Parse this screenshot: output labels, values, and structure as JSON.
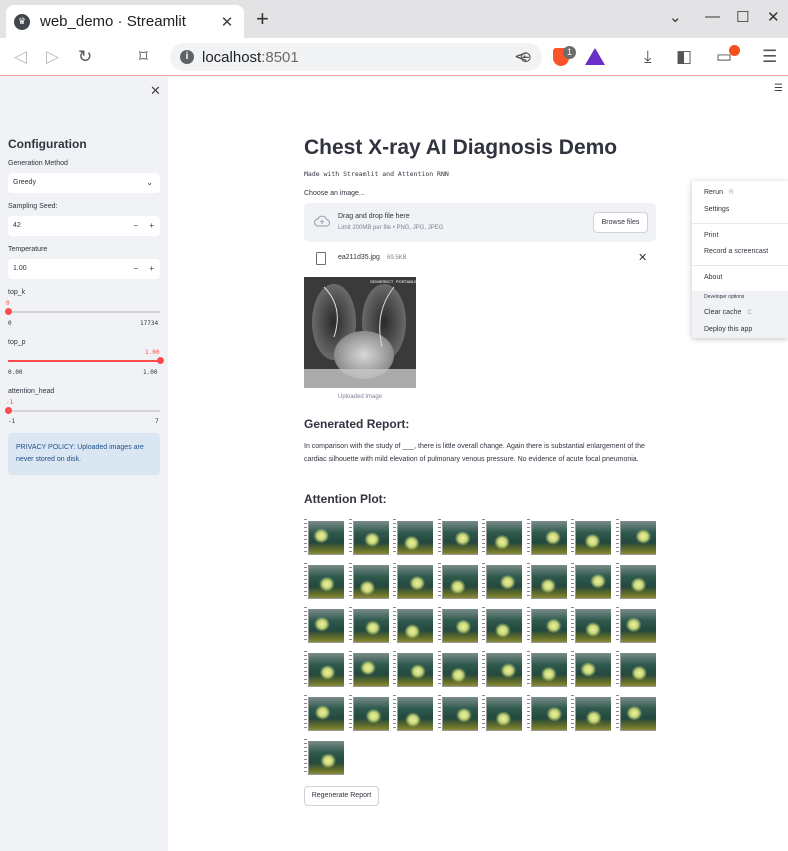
{
  "browser": {
    "tab_title": "web_demo · Streamlit",
    "url_host": "localhost",
    "url_port": ":8501",
    "brave_badge": "1"
  },
  "sidebar": {
    "title": "Configuration",
    "generation_method": {
      "label": "Generation Method",
      "value": "Greedy"
    },
    "sampling_seed": {
      "label": "Sampling Seed:",
      "value": "42"
    },
    "temperature": {
      "label": "Temperature",
      "value": "1.00"
    },
    "top_k": {
      "label": "top_k",
      "value": "0",
      "min": "0",
      "max": "17734",
      "fraction": 0.0
    },
    "top_p": {
      "label": "top_p",
      "value": "1.00",
      "min": "0.00",
      "max": "1.00",
      "fraction": 1.0
    },
    "attention_head": {
      "label": "attention_head",
      "value": "-1",
      "min": "-1",
      "max": "7",
      "fraction": 0.0
    },
    "privacy": "PRIVACY POLICY: Uploaded images are never stored on disk."
  },
  "main": {
    "title": "Chest X-ray AI Diagnosis Demo",
    "subtitle": "Made with Streamlit and Attention RNN",
    "uploader": {
      "label": "Choose an image...",
      "drop_title": "Drag and drop file here",
      "drop_sub": "Limit 200MB per file • PNG, JPG, JPEG",
      "browse": "Browse files"
    },
    "file": {
      "name": "ea211d35.jpg",
      "size": "69.5KB"
    },
    "image_caption": "Uploaded Image",
    "report_heading": "Generated Report:",
    "report_text": "In comparison with the study of ___, there is little overall change. Again there is substantial enlargement of the cardiac silhouette with mild elevation of pulmonary venous pressure. No evidence of acute focal pneumonia.",
    "attention_heading": "Attention Plot:",
    "attention_tiles": 41,
    "regenerate": "Regenerate Report"
  },
  "menu": {
    "rerun": "Rerun",
    "rerun_key": "R",
    "settings": "Settings",
    "print": "Print",
    "record": "Record a screencast",
    "about": "About",
    "dev_label": "Developer options",
    "clear_cache": "Clear cache",
    "clear_key": "C",
    "deploy": "Deploy this app"
  },
  "colors": {
    "accent": "#ff4b4b",
    "sidebar_bg": "#f0f2f6",
    "info_bg": "#dbe6f3"
  }
}
